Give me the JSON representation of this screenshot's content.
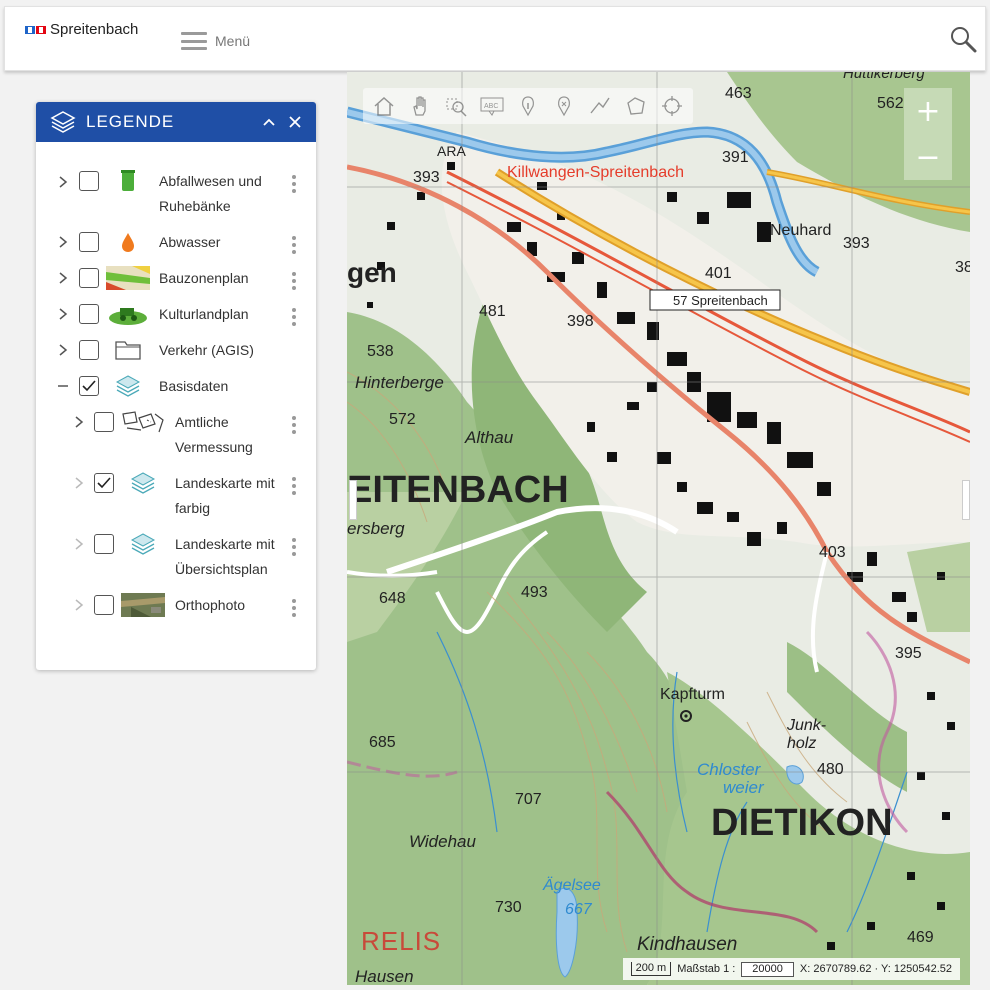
{
  "app": {
    "brand": "Spreitenbach",
    "menu_label": "Menü"
  },
  "legend": {
    "title": "LEGENDE",
    "items": [
      {
        "label": "Abfallwesen und Ruhebänke",
        "checked": false,
        "icon": "trash-bin-icon"
      },
      {
        "label": "Abwasser",
        "checked": false,
        "icon": "water-drop-icon"
      },
      {
        "label": "Bauzonenplan",
        "checked": false,
        "icon": "zoning-map-icon"
      },
      {
        "label": "Kulturlandplan",
        "checked": false,
        "icon": "farmland-icon"
      },
      {
        "label": "Verkehr (AGIS)",
        "checked": false,
        "icon": "folder-icon"
      },
      {
        "label": "Basisdaten",
        "checked": true,
        "icon": "layers-icon"
      },
      {
        "label": "Amtliche Vermessung",
        "checked": false,
        "icon": "cadastre-icon"
      },
      {
        "label": "Landeskarte mit farbig",
        "checked": true,
        "icon": "layers-icon"
      },
      {
        "label": "Landeskarte mit Übersichtsplan",
        "checked": false,
        "icon": "layers-icon"
      },
      {
        "label": "Orthophoto",
        "checked": false,
        "icon": "orthophoto-icon"
      }
    ]
  },
  "map": {
    "labels": {
      "station": "Killwangen-Spreitenbach",
      "bus": "57 Spreitenbach",
      "town1": "EITENBACH",
      "town2": "DIETIKON",
      "hinterberge": "Hinterberge",
      "althau": "Althau",
      "kapfturm": "Kapfturm",
      "junkholz": "Junk-\nholz",
      "chloster": "Chloster",
      "weier": "weier",
      "widehau": "Widehau",
      "agelsee": "Ägelsee",
      "kindhausen": "Kindhausen",
      "hausen": "Hausen",
      "neuhard": "Neuhard",
      "ara": "ARA",
      "ersberg": "ersberg",
      "gen": "gen",
      "hutt": "Huttikerberg"
    },
    "heights": [
      "463",
      "562",
      "391",
      "393",
      "401",
      "481",
      "398",
      "538",
      "572",
      "393",
      "403",
      "395",
      "480",
      "685",
      "707",
      "730",
      "667",
      "493",
      "648",
      "469",
      "38"
    ],
    "brand": "RELIS",
    "zoom_in": "+",
    "zoom_out": "−",
    "scale_distance": "200 m",
    "scale_label": "Maßstab 1 :",
    "scale_value": "20000",
    "coords": "X: 2670789.62 · Y: 1250542.52"
  }
}
